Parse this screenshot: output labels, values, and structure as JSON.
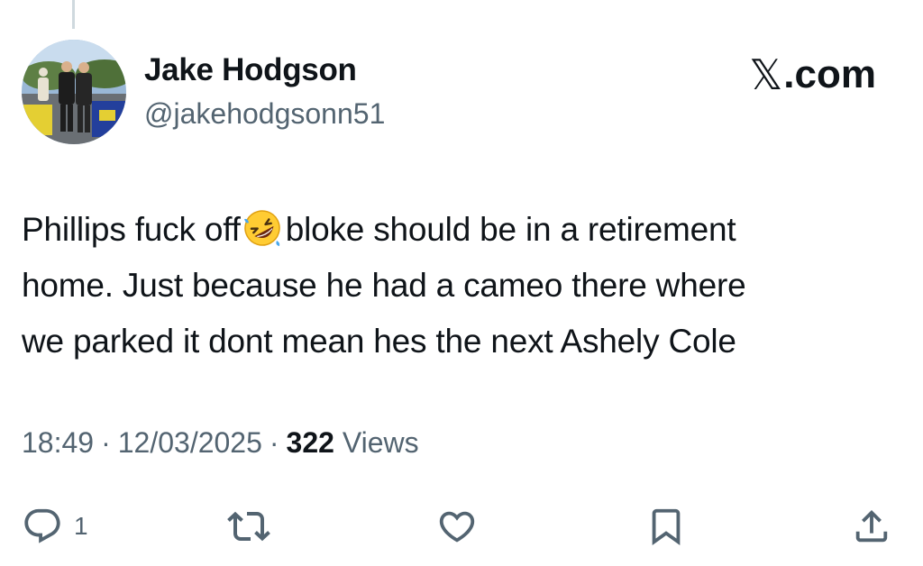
{
  "author": {
    "display_name": "Jake Hodgson",
    "handle": "@jakehodgsonn51",
    "avatar_icon": "avatar-photo"
  },
  "brand": {
    "label": ".com",
    "logo_icon": "x-logo-icon"
  },
  "tweet": {
    "text_line1_before": "Phillips fuck off",
    "emoji": "rolling-on-the-floor-laughing-emoji",
    "text_line1_after": "bloke should be in a retirement",
    "text_line2": "home. Just because he had a cameo there where",
    "text_line3": "we parked it dont mean hes the next Ashely Cole"
  },
  "meta": {
    "time": "18:49",
    "date": "12/03/2025",
    "views_count": "322",
    "views_label": "Views",
    "separator": "·"
  },
  "actions": {
    "reply_count": "1",
    "reply_icon": "reply-icon",
    "retweet_icon": "retweet-icon",
    "like_icon": "heart-icon",
    "bookmark_icon": "bookmark-icon",
    "share_icon": "share-icon"
  },
  "colors": {
    "text": "#0f1419",
    "secondary_text": "#536471",
    "thread_line": "#cfd9de",
    "background": "#ffffff"
  }
}
